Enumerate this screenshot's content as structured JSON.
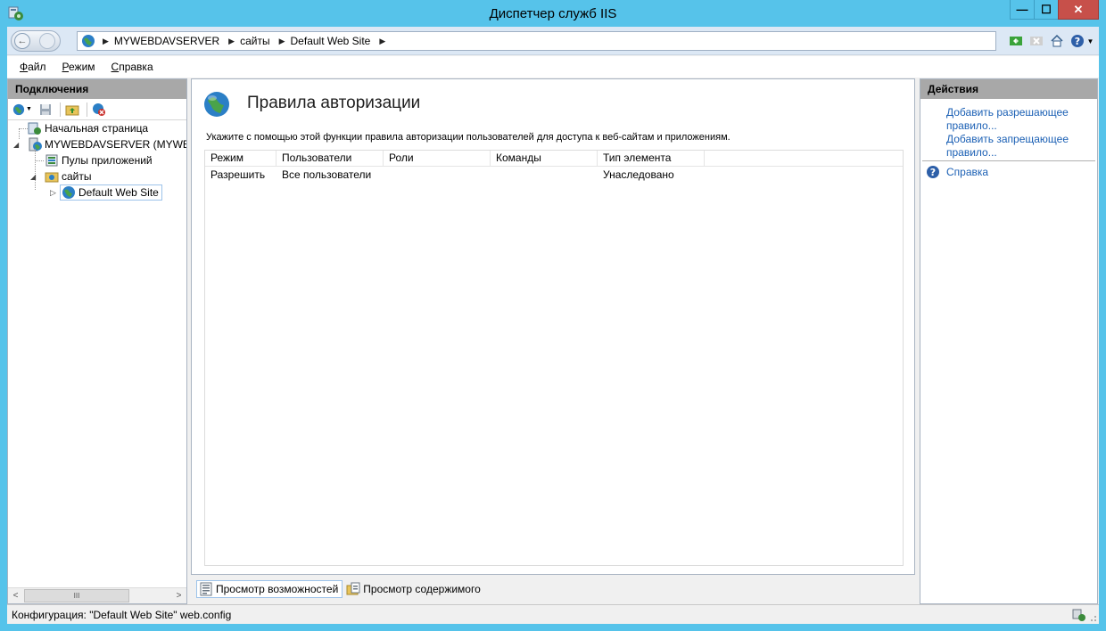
{
  "window": {
    "title": "Диспетчер служб IIS",
    "controls": {
      "minimize": "—",
      "maximize": "☐",
      "close": "✕"
    }
  },
  "address": {
    "crumbs": [
      "MYWEBDAVSERVER",
      "сайты",
      "Default Web Site"
    ]
  },
  "menu": {
    "items": [
      "Файл",
      "Режим",
      "Справка"
    ]
  },
  "connections": {
    "header": "Подключения",
    "tree": {
      "start_page": "Начальная страница",
      "server": "MYWEBDAVSERVER (MYWEBD",
      "app_pools": "Пулы приложений",
      "sites": "сайты",
      "default_site": "Default Web Site"
    }
  },
  "main": {
    "title": "Правила авторизации",
    "description": "Укажите с помощью этой функции правила авторизации пользователей для доступа к веб-сайтам и приложениям.",
    "columns": [
      "Режим",
      "Пользователи",
      "Роли",
      "Команды",
      "Тип элемента"
    ],
    "rows": [
      {
        "mode": "Разрешить",
        "users": "Все пользователи",
        "roles": "",
        "verbs": "",
        "entry_type": "Унаследовано"
      }
    ]
  },
  "view_tabs": {
    "features": "Просмотр возможностей",
    "content": "Просмотр содержимого"
  },
  "actions": {
    "header": "Действия",
    "add_allow_line1": "Добавить разрешающее",
    "add_allow_line2": "правило...",
    "add_deny_line1": "Добавить запрещающее",
    "add_deny_line2": "правило...",
    "help": "Справка"
  },
  "status": {
    "text": "Конфигурация: \"Default Web Site\" web.config"
  },
  "colors": {
    "frame": "#56c3ea",
    "link": "#1a5fb4",
    "pane_header": "#a8a8a8",
    "close_button": "#c7504a"
  }
}
